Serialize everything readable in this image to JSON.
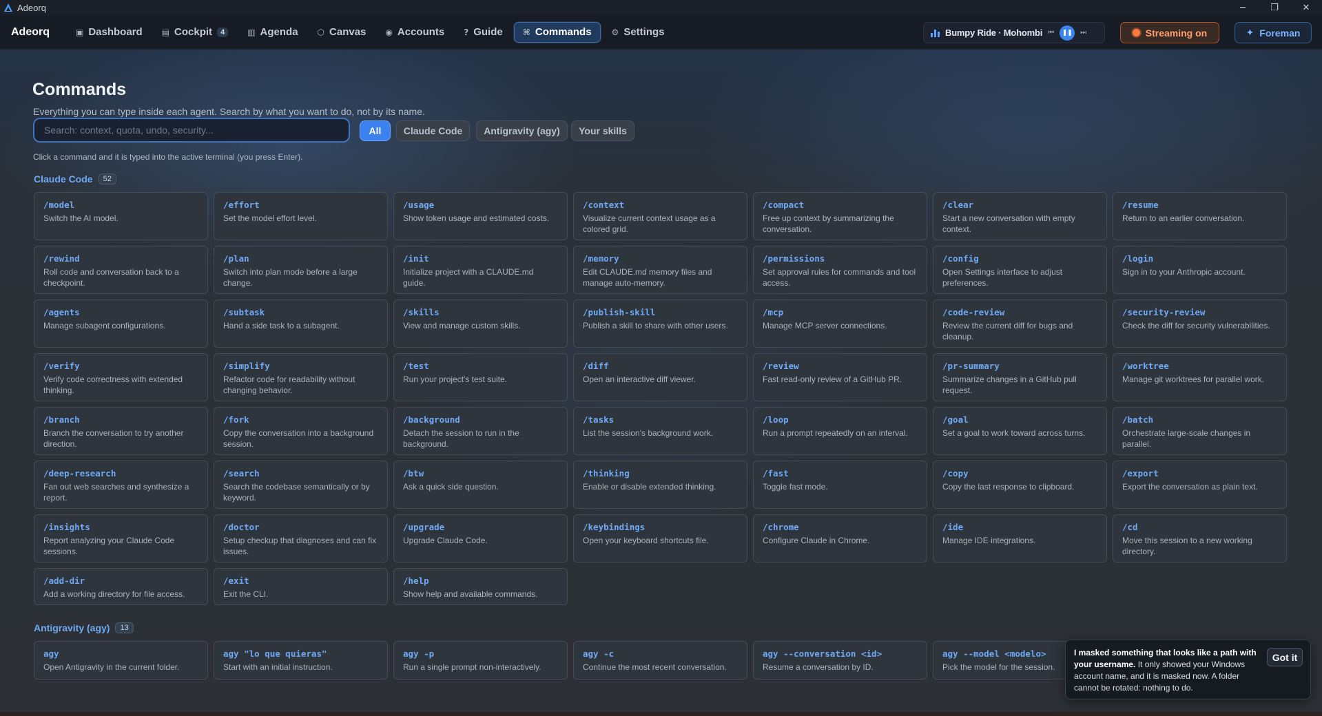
{
  "window": {
    "title": "Adeorq",
    "controls": [
      "─",
      "❐",
      "✕"
    ]
  },
  "nav": {
    "brand": "Adeorq",
    "items": [
      {
        "label": "Dashboard",
        "icon": "▣",
        "icon_name": "dashboard-icon"
      },
      {
        "label": "Cockpit",
        "icon": "▤",
        "icon_name": "cockpit-icon",
        "count": "4"
      },
      {
        "label": "Agenda",
        "icon": "▥",
        "icon_name": "agenda-icon"
      },
      {
        "label": "Canvas",
        "icon": "⬡",
        "icon_name": "canvas-icon"
      },
      {
        "label": "Accounts",
        "icon": "◉",
        "icon_name": "accounts-icon"
      },
      {
        "label": "Guide",
        "icon": "?",
        "icon_name": "guide-icon"
      },
      {
        "label": "Commands",
        "icon": "⌘",
        "icon_name": "command-icon",
        "active": true
      },
      {
        "label": "Settings",
        "icon": "⚙",
        "icon_name": "gear-icon"
      }
    ],
    "player": {
      "track": "Bumpy Ride · Mohombi",
      "prev": "⏮",
      "pause": "❚❚",
      "next": "⏭"
    },
    "streaming_label": "Streaming on",
    "foreman_label": "Foreman",
    "foreman_icon": "✦"
  },
  "page": {
    "title": "Commands",
    "subtitle": "Everything you can type inside each agent. Search by what you want to do, not by its name.",
    "search_placeholder": "Search: context, quota, undo, security...",
    "filters": [
      "All",
      "Claude Code",
      "Antigravity (agy)",
      "Your skills"
    ],
    "active_filter": "All",
    "hint": "Click a command and it is typed into the active terminal (you press Enter)."
  },
  "sections": [
    {
      "label": "Claude Code",
      "count": "52",
      "commands": [
        {
          "cmd": "/model",
          "desc": "Switch the AI model."
        },
        {
          "cmd": "/effort",
          "desc": "Set the model effort level."
        },
        {
          "cmd": "/usage",
          "desc": "Show token usage and estimated costs."
        },
        {
          "cmd": "/context",
          "desc": "Visualize current context usage as a colored grid."
        },
        {
          "cmd": "/compact",
          "desc": "Free up context by summarizing the conversation."
        },
        {
          "cmd": "/clear",
          "desc": "Start a new conversation with empty context."
        },
        {
          "cmd": "/resume",
          "desc": "Return to an earlier conversation."
        },
        {
          "cmd": "/rewind",
          "desc": "Roll code and conversation back to a checkpoint."
        },
        {
          "cmd": "/plan",
          "desc": "Switch into plan mode before a large change."
        },
        {
          "cmd": "/init",
          "desc": "Initialize project with a CLAUDE.md guide."
        },
        {
          "cmd": "/memory",
          "desc": "Edit CLAUDE.md memory files and manage auto-memory."
        },
        {
          "cmd": "/permissions",
          "desc": "Set approval rules for commands and tool access."
        },
        {
          "cmd": "/config",
          "desc": "Open Settings interface to adjust preferences."
        },
        {
          "cmd": "/login",
          "desc": "Sign in to your Anthropic account."
        },
        {
          "cmd": "/agents",
          "desc": "Manage subagent configurations."
        },
        {
          "cmd": "/subtask",
          "desc": "Hand a side task to a subagent."
        },
        {
          "cmd": "/skills",
          "desc": "View and manage custom skills."
        },
        {
          "cmd": "/publish-skill",
          "desc": "Publish a skill to share with other users."
        },
        {
          "cmd": "/mcp",
          "desc": "Manage MCP server connections."
        },
        {
          "cmd": "/code-review",
          "desc": "Review the current diff for bugs and cleanup."
        },
        {
          "cmd": "/security-review",
          "desc": "Check the diff for security vulnerabilities."
        },
        {
          "cmd": "/verify",
          "desc": "Verify code correctness with extended thinking."
        },
        {
          "cmd": "/simplify",
          "desc": "Refactor code for readability without changing behavior."
        },
        {
          "cmd": "/test",
          "desc": "Run your project's test suite."
        },
        {
          "cmd": "/diff",
          "desc": "Open an interactive diff viewer."
        },
        {
          "cmd": "/review",
          "desc": "Fast read-only review of a GitHub PR."
        },
        {
          "cmd": "/pr-summary",
          "desc": "Summarize changes in a GitHub pull request."
        },
        {
          "cmd": "/worktree",
          "desc": "Manage git worktrees for parallel work."
        },
        {
          "cmd": "/branch",
          "desc": "Branch the conversation to try another direction."
        },
        {
          "cmd": "/fork",
          "desc": "Copy the conversation into a background session."
        },
        {
          "cmd": "/background",
          "desc": "Detach the session to run in the background."
        },
        {
          "cmd": "/tasks",
          "desc": "List the session's background work."
        },
        {
          "cmd": "/loop",
          "desc": "Run a prompt repeatedly on an interval."
        },
        {
          "cmd": "/goal",
          "desc": "Set a goal to work toward across turns."
        },
        {
          "cmd": "/batch",
          "desc": "Orchestrate large-scale changes in parallel."
        },
        {
          "cmd": "/deep-research",
          "desc": "Fan out web searches and synthesize a report."
        },
        {
          "cmd": "/search",
          "desc": "Search the codebase semantically or by keyword."
        },
        {
          "cmd": "/btw",
          "desc": "Ask a quick side question."
        },
        {
          "cmd": "/thinking",
          "desc": "Enable or disable extended thinking."
        },
        {
          "cmd": "/fast",
          "desc": "Toggle fast mode."
        },
        {
          "cmd": "/copy",
          "desc": "Copy the last response to clipboard."
        },
        {
          "cmd": "/export",
          "desc": "Export the conversation as plain text."
        },
        {
          "cmd": "/insights",
          "desc": "Report analyzing your Claude Code sessions."
        },
        {
          "cmd": "/doctor",
          "desc": "Setup checkup that diagnoses and can fix issues."
        },
        {
          "cmd": "/upgrade",
          "desc": "Upgrade Claude Code."
        },
        {
          "cmd": "/keybindings",
          "desc": "Open your keyboard shortcuts file."
        },
        {
          "cmd": "/chrome",
          "desc": "Configure Claude in Chrome."
        },
        {
          "cmd": "/ide",
          "desc": "Manage IDE integrations."
        },
        {
          "cmd": "/cd",
          "desc": "Move this session to a new working directory."
        },
        {
          "cmd": "/add-dir",
          "desc": "Add a working directory for file access."
        },
        {
          "cmd": "/exit",
          "desc": "Exit the CLI."
        },
        {
          "cmd": "/help",
          "desc": "Show help and available commands."
        }
      ]
    },
    {
      "label": "Antigravity (agy)",
      "count": "13",
      "commands": [
        {
          "cmd": "agy",
          "desc": "Open Antigravity in the current folder."
        },
        {
          "cmd": "agy \"lo que quieras\"",
          "desc": "Start with an initial instruction."
        },
        {
          "cmd": "agy -p",
          "desc": "Run a single prompt non-interactively."
        },
        {
          "cmd": "agy -c",
          "desc": "Continue the most recent conversation."
        },
        {
          "cmd": "agy --conversation <id>",
          "desc": "Resume a conversation by ID."
        },
        {
          "cmd": "agy --model <modelo>",
          "desc": "Pick the model for the session."
        }
      ]
    }
  ],
  "toast": {
    "bold": "I masked something that looks like a path with your username.",
    "text": " It only showed your Windows account name, and it is masked now. A folder cannot be rotated: nothing to do.",
    "button": "Got it"
  }
}
